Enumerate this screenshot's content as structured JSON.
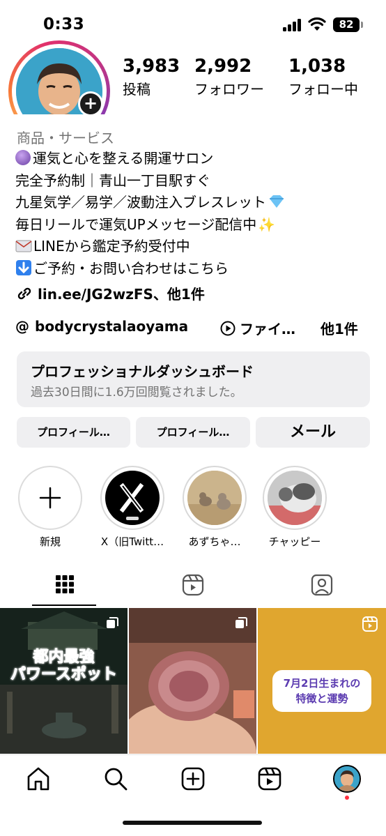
{
  "status_bar": {
    "time": "0:33",
    "battery": "82"
  },
  "profile": {
    "stats": [
      {
        "count": "3,983",
        "label": "投稿"
      },
      {
        "count": "2,992",
        "label": "フォロワー"
      },
      {
        "count": "1,038",
        "label": "フォロー中"
      }
    ],
    "category": "商品・サービス",
    "bio": [
      {
        "emoji": "crystal-ball",
        "color": "#7b4bb0",
        "text": "運気と心を整える開運サロン"
      },
      {
        "emoji": "",
        "color": "",
        "text": "完全予約制｜青山一丁目駅すぐ"
      },
      {
        "emoji": "",
        "color": "",
        "text": "九星気学／易学／波動注入ブレスレット"
      },
      {
        "emoji": "",
        "color": "",
        "text": "毎日リールで運気UPメッセージ配信中"
      },
      {
        "emoji": "envelope",
        "color": "#d7d7de",
        "text": "LINEから鑑定予約受付中"
      },
      {
        "emoji": "down-arrow",
        "color": "#2f80ed",
        "text": "ご予約・お問い合わせはこちら"
      }
    ],
    "link": "lin.ee/JG2wzFS、他1件",
    "threads_handle": "bodycrystalaoyama",
    "threads_extra": "ファイ…",
    "threads_more": "他1件"
  },
  "dashboard": {
    "title": "プロフェッショナルダッシュボード",
    "subtitle": "過去30日間に1.6万回閲覧されました。"
  },
  "actions": {
    "button1": "プロフィール…",
    "button2": "プロフィール…",
    "button3": "メール"
  },
  "highlights": [
    {
      "label": "新規"
    },
    {
      "label": "X（旧Twitt…"
    },
    {
      "label": "あずちゃ…"
    },
    {
      "label": "チャッピー"
    }
  ],
  "posts": [
    {
      "caption": "都内最強\nパワースポット"
    },
    {
      "caption": ""
    },
    {
      "caption": "7月2日生まれの\n特徴と運勢"
    }
  ],
  "colors": {
    "accent": "#e1306c",
    "surface": "#efeff1",
    "muted": "#737373",
    "reel_bg": "#e0a62f"
  }
}
